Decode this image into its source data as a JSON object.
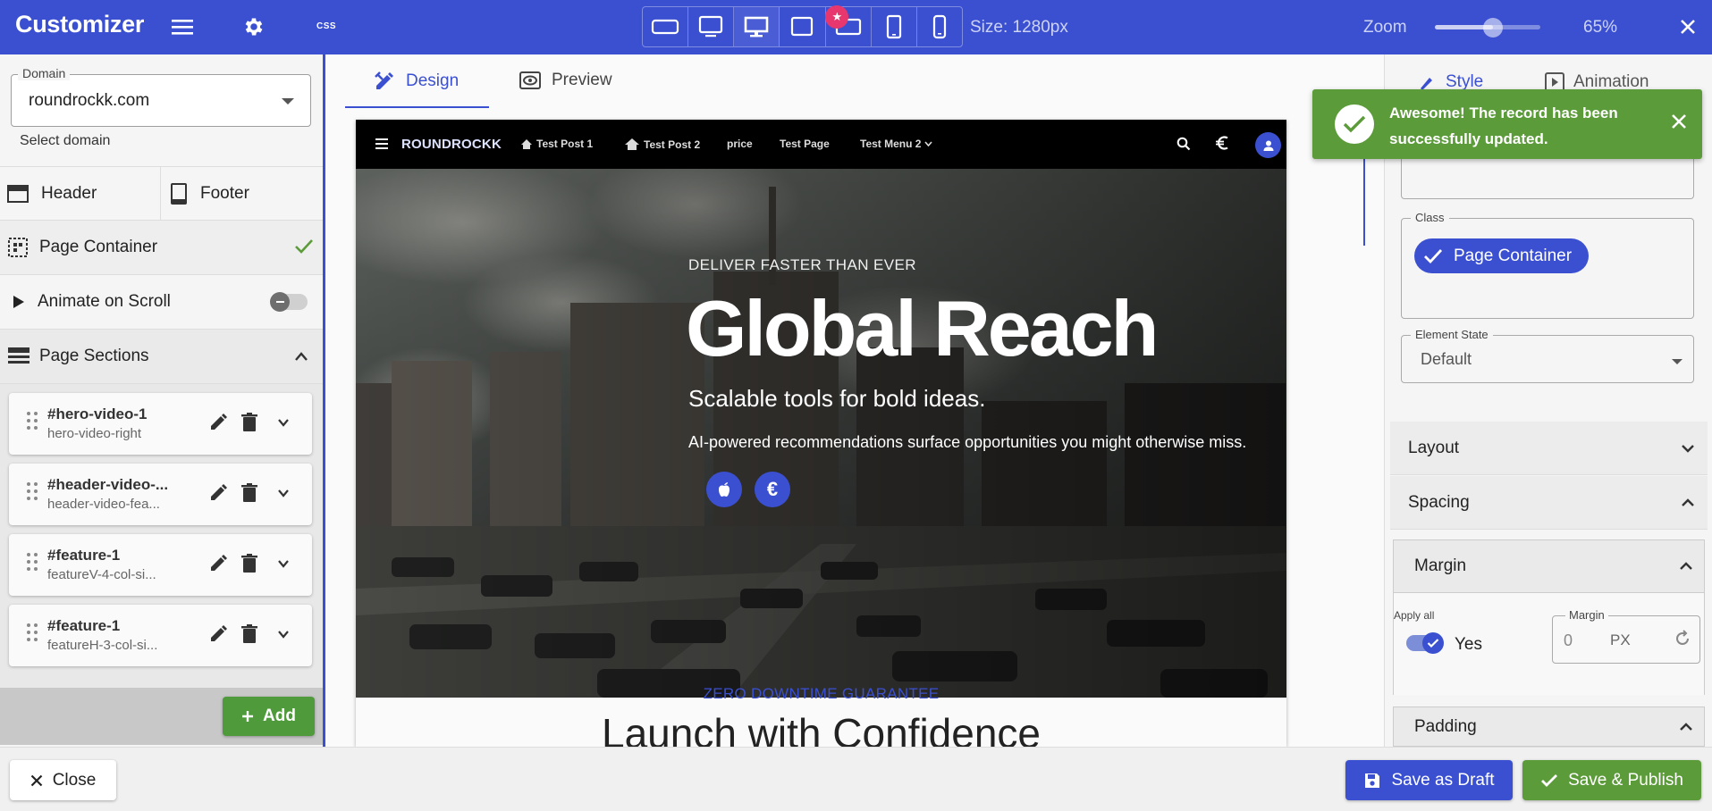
{
  "topbar": {
    "app_title": "Customizer",
    "css_label": "CSS",
    "device_badge": "★",
    "size_label": "Size: 1280px",
    "zoom_label": "Zoom",
    "zoom_value": "65%",
    "zoom_level": 0.55,
    "devices": [
      "desktop-wide",
      "monitor",
      "desktop",
      "laptop",
      "tablet-landscape",
      "tablet",
      "phone"
    ],
    "active_device": "desktop"
  },
  "left": {
    "domain_label": "Domain",
    "domain_value": "roundrockk.com",
    "domain_help": "Select domain",
    "header_tab": "Header",
    "footer_tab": "Footer",
    "page_container": "Page Container",
    "animate_on_scroll": "Animate on Scroll",
    "page_sections": "Page Sections",
    "sections": [
      {
        "id": "#hero-video-1",
        "template": "hero-video-right"
      },
      {
        "id": "#header-video-...",
        "template": "header-video-fea..."
      },
      {
        "id": "#feature-1",
        "template": "featureV-4-col-si..."
      },
      {
        "id": "#feature-1",
        "template": "featureH-3-col-si..."
      }
    ],
    "add_label": "Add"
  },
  "center": {
    "tab_design": "Design",
    "tab_preview": "Preview",
    "site": {
      "brand": "ROUNDROCKK",
      "nav": [
        "Test Post 1",
        "Test Post 2",
        "price",
        "Test Page",
        "Test Menu 2"
      ],
      "hero_eyebrow": "DELIVER FASTER THAN EVER",
      "hero_title": "Global Reach",
      "hero_subtitle": "Scalable tools for bold ideas.",
      "hero_description": "AI-powered recommendations surface opportunities you might otherwise miss.",
      "hero_btn_euro": "€",
      "section_eyebrow": "ZERO DOWNTIME GUARANTEE",
      "section_title": "Launch with Confidence"
    }
  },
  "right": {
    "tab_style": "Style",
    "tab_animation": "Animation",
    "class_label": "Class",
    "class_chip": "Page Container",
    "state_label": "Element State",
    "state_value": "Default",
    "layout": "Layout",
    "spacing": "Spacing",
    "margin": "Margin",
    "apply_all": "Apply all",
    "apply_yes": "Yes",
    "margin_field_label": "Margin",
    "margin_value": "0",
    "margin_unit": "PX",
    "padding": "Padding"
  },
  "toast": {
    "message": "Awesome! The record has been successfully updated."
  },
  "bottom": {
    "close": "Close",
    "save_draft": "Save as Draft",
    "save_publish": "Save & Publish"
  },
  "colors": {
    "primary": "#3b50d1",
    "success": "#5c9b3a",
    "badge": "#e8376e"
  }
}
